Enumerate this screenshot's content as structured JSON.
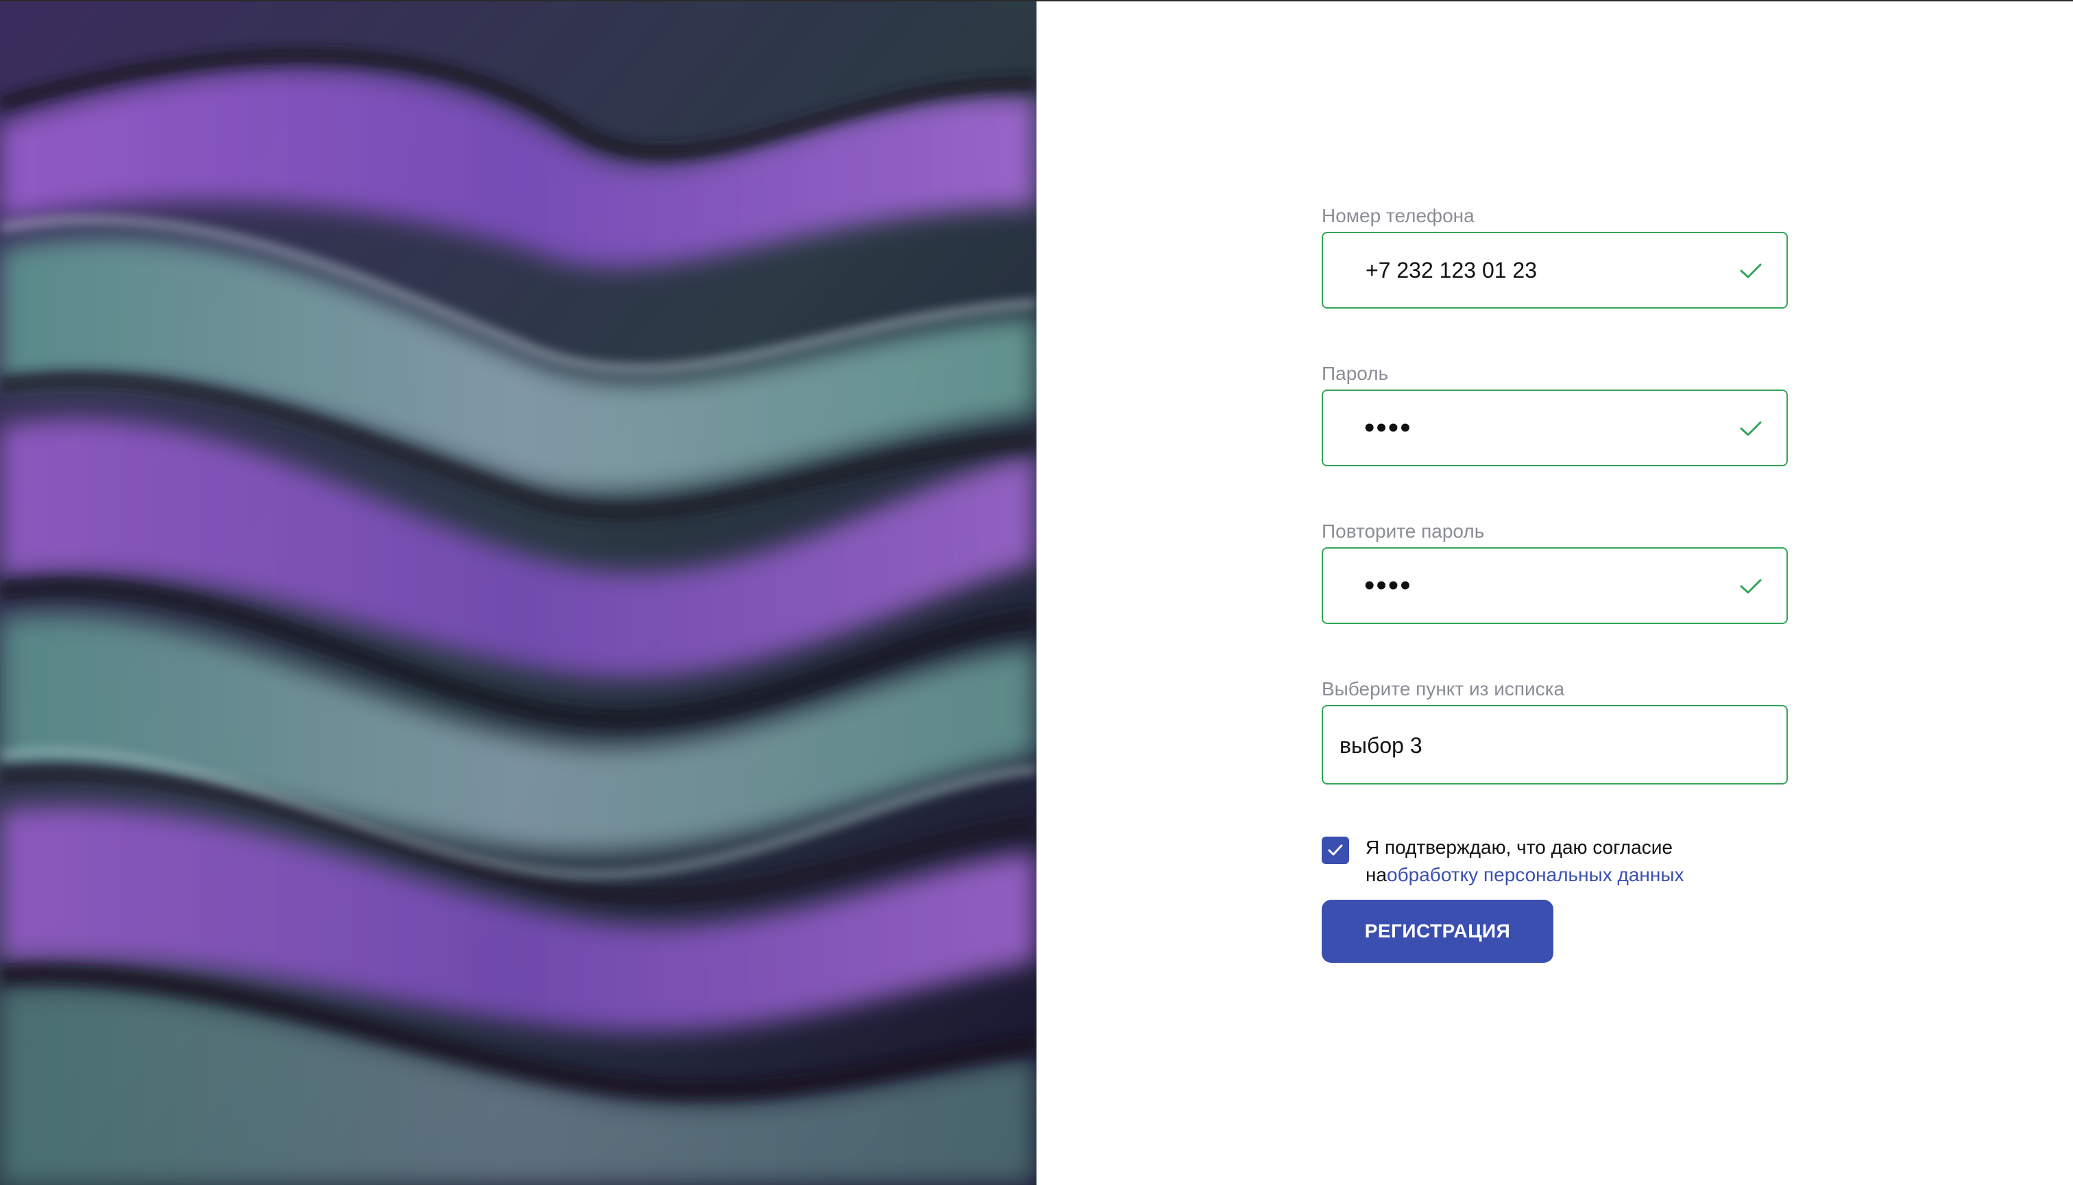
{
  "form": {
    "phone": {
      "label": "Номер телефона",
      "value": "+7 232 123 01 23"
    },
    "password": {
      "label": "Пароль",
      "value": "••••"
    },
    "confirm_password": {
      "label": "Повторите пароль",
      "value": "••••"
    },
    "select": {
      "label": "Выберите пункт из исписка",
      "value": "выбор 3"
    },
    "consent": {
      "checked": true,
      "text_line1": "Я подтверждаю, что даю согласие",
      "text_prefix": "на",
      "link_text": "обработку персональных данных"
    },
    "submit_label": "РЕГИСТРАЦИЯ"
  },
  "colors": {
    "accent": "#3a4fb0",
    "valid_border": "#33a457",
    "label_gray": "#8a8d96"
  },
  "icons": {
    "valid": "check-icon",
    "checkbox": "checkmark-icon"
  }
}
